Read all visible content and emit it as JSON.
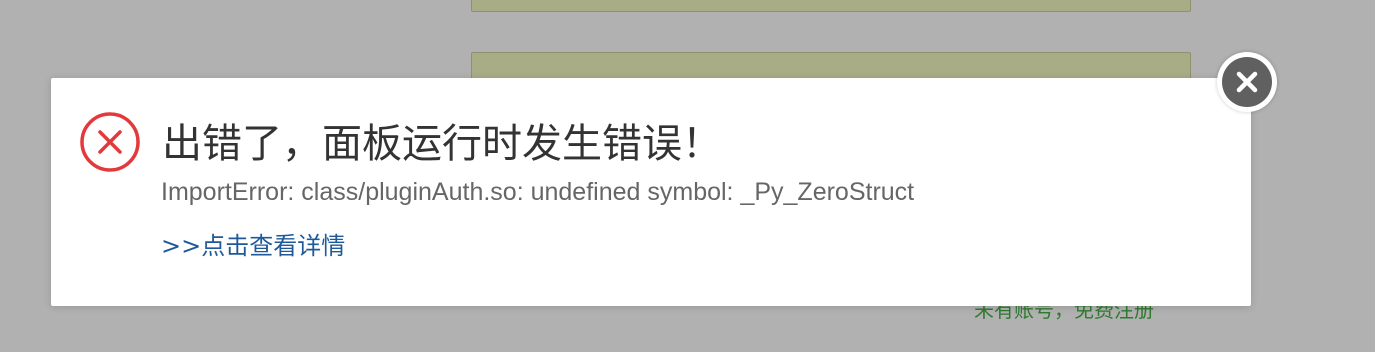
{
  "background": {
    "register_link": "未有账号，免费注册"
  },
  "dialog": {
    "title": "出错了，面板运行时发生错误！",
    "message": "ImportError: class/pluginAuth.so: undefined symbol: _Py_ZeroStruct",
    "details_link": ">>点击查看详情",
    "icon": "error-circle-x",
    "close_icon": "close-x"
  },
  "colors": {
    "error_red": "#e4393c",
    "link_blue": "#1e5a99",
    "close_bg": "#606060"
  }
}
